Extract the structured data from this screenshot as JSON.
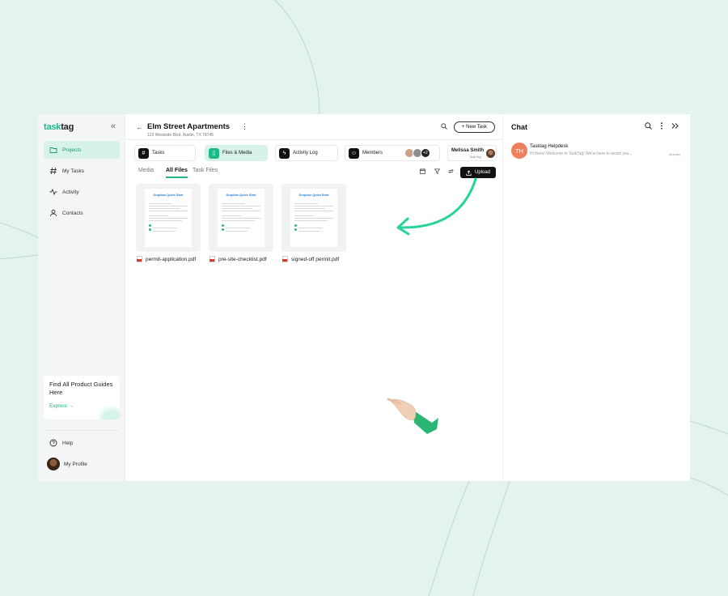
{
  "colors": {
    "brand": "#1fb887",
    "bg": "#e4f4ed",
    "active_nav": "#d7f2e6",
    "avatar_th": "#f07f5d"
  },
  "sidebar": {
    "logo_a": "task",
    "logo_b": "tag",
    "collapse_icon": "«",
    "items": [
      {
        "label": "Projects",
        "icon": "folder-icon",
        "active": true
      },
      {
        "label": "My Tasks",
        "icon": "hash-icon"
      },
      {
        "label": "Activity",
        "icon": "activity-icon"
      },
      {
        "label": "Contacts",
        "icon": "user-icon"
      }
    ],
    "guide": {
      "title": "Find All Product Guides Here",
      "cta": "Explore →"
    },
    "help": "Help",
    "profile": "My Profile"
  },
  "project": {
    "back": "←",
    "title": "Elm Street Apartments",
    "more": "⋮",
    "address": "123 Westside Blvd, Austin, TX 78745",
    "new_task": "+ New Task"
  },
  "tabs": [
    {
      "label": "Tasks",
      "icon": "#"
    },
    {
      "label": "Files & Media",
      "icon": "▯",
      "active": true
    },
    {
      "label": "Activity Log",
      "icon": "ϟ"
    },
    {
      "label": "Members",
      "icon": "☺",
      "extra": "+2"
    }
  ],
  "user": {
    "name": "Melissa Smith",
    "role": "TaskTag"
  },
  "subtabs": [
    {
      "label": "Media"
    },
    {
      "label": "All Files",
      "active": true
    },
    {
      "label": "Task Files"
    }
  ],
  "upload": "Upload",
  "files": [
    {
      "name": "permit-application.pdf",
      "doc_title": "Dropbox Quick Start"
    },
    {
      "name": "pre-site-checklist.pdf",
      "doc_title": "Dropbox Quick Start"
    },
    {
      "name": "signed-off permit.pdf",
      "doc_title": "Dropbox Quick Start"
    }
  ],
  "chat": {
    "title": "Chat",
    "conversations": [
      {
        "initials": "TH",
        "name": "Tasktag Helpdesk",
        "preview": "Hi there! Welcome to TaskTag! We're here to assist you...",
        "day": "Monday"
      }
    ]
  }
}
